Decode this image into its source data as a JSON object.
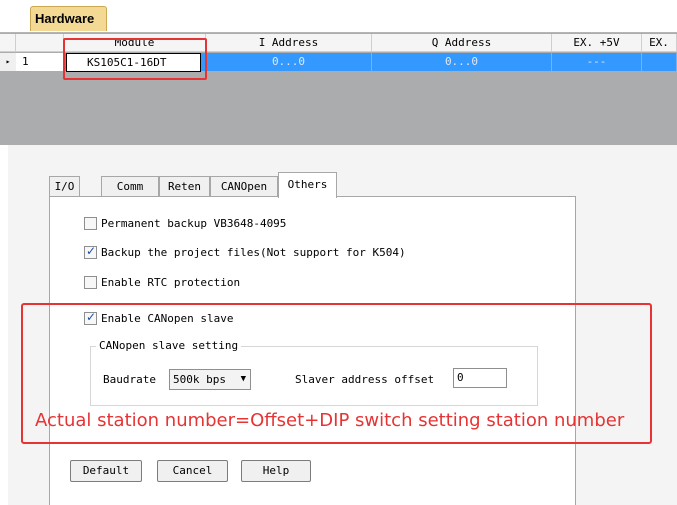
{
  "tabstrip": {
    "active_tab": "Hardware"
  },
  "grid": {
    "columns": [
      "Module",
      "I Address",
      "Q Address",
      "EX. +5V",
      "EX."
    ],
    "rows": [
      {
        "expand_glyph": "▸",
        "index": "1",
        "module": "KS105C1-16DT",
        "i_address": "0...0",
        "q_address": "0...0",
        "ex5v": "---",
        "ex": ""
      }
    ]
  },
  "dialog": {
    "tabs": [
      "I/O",
      "Comm",
      "Reten",
      "CANOpen",
      "Others"
    ],
    "active_tab": "Others",
    "options": [
      {
        "label": "Permanent backup VB3648-4095",
        "checked": false
      },
      {
        "label": "Backup the project files(Not support for K504)",
        "checked": true
      },
      {
        "label": "Enable RTC protection",
        "checked": false
      },
      {
        "label": "Enable CANopen slave",
        "checked": true
      }
    ],
    "canopen_group": {
      "title": "CANopen slave setting",
      "baudrate_label": "Baudrate",
      "baudrate_value": "500k bps",
      "offset_label": "Slaver address offset",
      "offset_value": "0"
    },
    "buttons": {
      "default": "Default",
      "cancel": "Cancel",
      "help": "Help"
    }
  },
  "annotation": {
    "text": "Actual station number=Offset+DIP switch setting station number",
    "color": "#e63333"
  },
  "colors": {
    "selection": "#3399ff",
    "tab_active": "#f3d993",
    "highlight": "#e63333"
  }
}
